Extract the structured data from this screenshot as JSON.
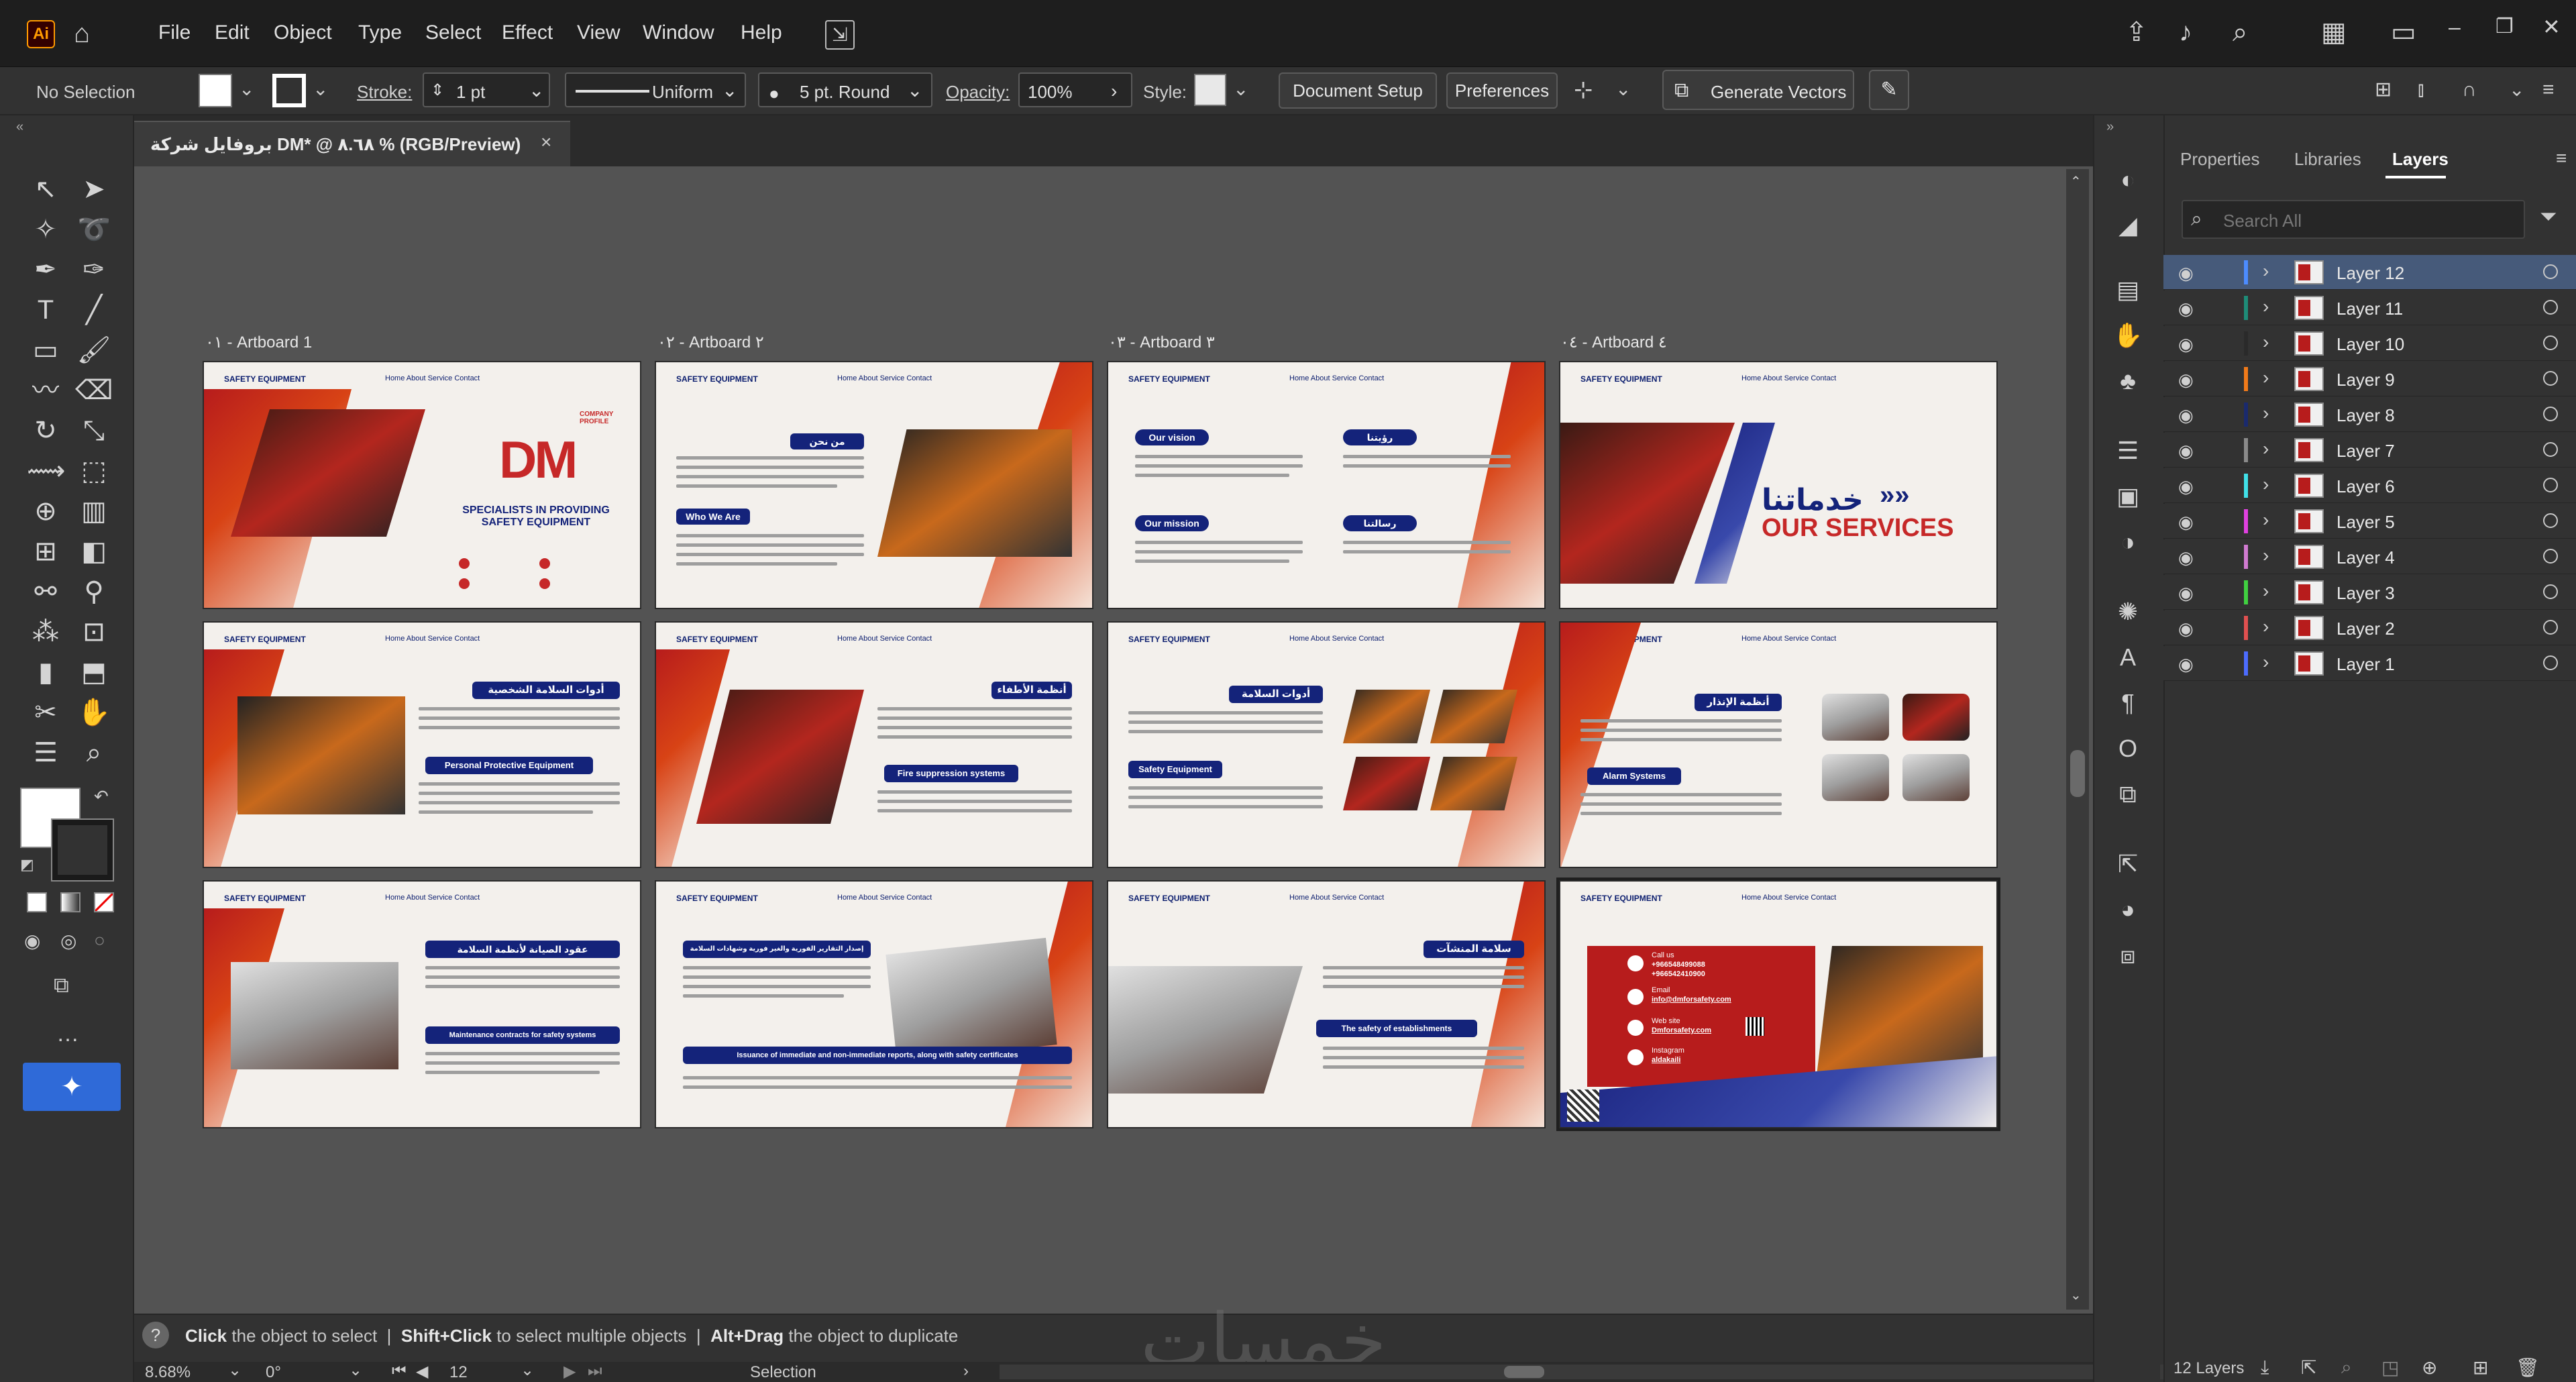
{
  "app": {
    "logo": "Ai",
    "menu": [
      "File",
      "Edit",
      "Object",
      "Type",
      "Select",
      "Effect",
      "View",
      "Window",
      "Help"
    ]
  },
  "control": {
    "selection": "No Selection",
    "stroke_label": "Stroke:",
    "stroke_value": "1 pt",
    "profile": "Uniform",
    "brush": "5 pt. Round",
    "opacity_label": "Opacity:",
    "opacity_value": "100%",
    "style_label": "Style:",
    "document_setup": "Document Setup",
    "preferences": "Preferences",
    "generate_vectors": "Generate Vectors"
  },
  "document": {
    "tab_title": "بروفايل شركة DM* @ ٨.٦٨ % (RGB/Preview)"
  },
  "artboards": [
    {
      "label": "٠١ - Artboard 1"
    },
    {
      "label": "٠٢ - Artboard ٢"
    },
    {
      "label": "٠٣ - Artboard ٣"
    },
    {
      "label": "٠٤ - Artboard ٤"
    }
  ],
  "slides": {
    "brand": "SAFETY EQUIPMENT",
    "nav": "Home   About   Service   Contact",
    "s1": {
      "logo": "DM",
      "company": "COMPANY PROFILE",
      "headline": "SPECIALISTS IN PROVIDING SAFETY EQUIPMENT"
    },
    "s2": {
      "ar_title": "من نحن",
      "en_title": "Who We Are"
    },
    "s3": {
      "vision": "Our vision",
      "mission": "Our mission",
      "ar_vision": "رؤيتنا",
      "ar_mission": "رسالتنا"
    },
    "s4": {
      "ar_title": "خدماتنا",
      "en_title": "OUR SERVICES"
    },
    "s5": {
      "ar_title": "أدوات السلامة الشخصية",
      "en_title": "Personal Protective Equipment"
    },
    "s6": {
      "ar_title": "أنظمة الأطفاء",
      "en_title": "Fire suppression systems"
    },
    "s7": {
      "ar_title": "أدوات السلامة",
      "en_title": "Safety Equipment"
    },
    "s8": {
      "ar_title": "أنظمة الإنذار",
      "en_title": "Alarm Systems"
    },
    "s9": {
      "ar_title": "عقود الصيانة لأنظمة السلامة",
      "en_title": "Maintenance contracts for safety systems"
    },
    "s10": {
      "ar_title": "إصدار التقارير الفورية والغير فورية وشهادات السلامة",
      "en_title": "Issuance of immediate and non-immediate reports, along with safety certificates"
    },
    "s11": {
      "ar_title": "سلامة المنشآت",
      "en_title": "The safety of establishments"
    },
    "s12": {
      "call_label": "Call us",
      "phone1": "+966548499088",
      "phone2": "+966542410900",
      "email_label": "Email",
      "email": "info@dmforsafety.com",
      "web_label": "Web site",
      "web": "Dmforsafety.com",
      "insta_label": "Instagram",
      "insta": "aldakaili"
    }
  },
  "status": {
    "hint_click": "Click",
    "hint_click_rest": "the object to select",
    "hint_shift": "Shift+Click",
    "hint_shift_rest": "to select multiple objects",
    "hint_alt": "Alt+Drag",
    "hint_alt_rest": "the object to duplicate",
    "zoom": "8.68%",
    "rotation": "0°",
    "artboard_num": "12",
    "mode": "Selection",
    "watermark": "خمسات"
  },
  "panel": {
    "tabs": [
      "Properties",
      "Libraries",
      "Layers"
    ],
    "search_placeholder": "Search All",
    "footer": "12 Layers",
    "layers": [
      {
        "name": "Layer 12",
        "color": "#4c8cff"
      },
      {
        "name": "Layer 11",
        "color": "#1e8c78"
      },
      {
        "name": "Layer 10",
        "color": "#2a2a2a"
      },
      {
        "name": "Layer 9",
        "color": "#f07a1a"
      },
      {
        "name": "Layer 8",
        "color": "#1a2a6e"
      },
      {
        "name": "Layer 7",
        "color": "#8a8a8a"
      },
      {
        "name": "Layer 6",
        "color": "#40e0e8"
      },
      {
        "name": "Layer 5",
        "color": "#e040e0"
      },
      {
        "name": "Layer 4",
        "color": "#d07ad0"
      },
      {
        "name": "Layer 3",
        "color": "#40d040"
      },
      {
        "name": "Layer 2",
        "color": "#e05050"
      },
      {
        "name": "Layer 1",
        "color": "#4c6cff"
      }
    ]
  }
}
